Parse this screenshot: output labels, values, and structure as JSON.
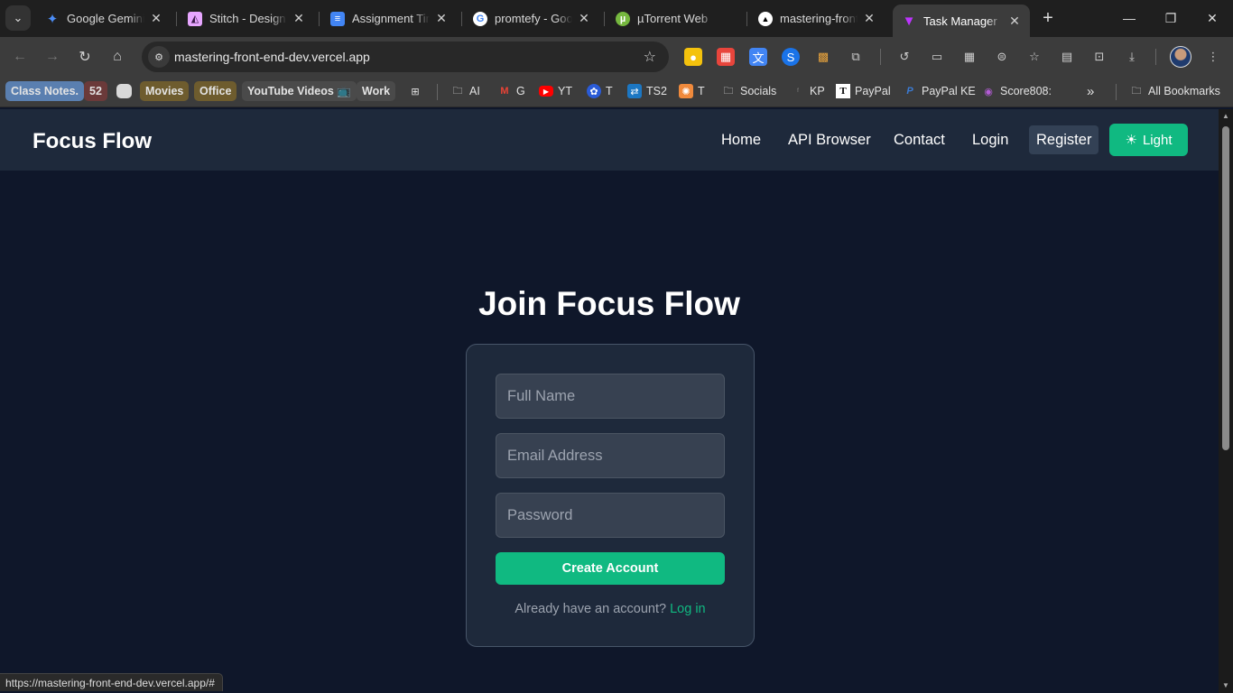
{
  "browser": {
    "tabs": [
      {
        "title": "Google Gemini",
        "icon": "gemini-icon",
        "color": "#4c8df6"
      },
      {
        "title": "Stitch - Design w",
        "icon": "stitch-icon",
        "color": "#e7a6ff"
      },
      {
        "title": "Assignment Tim",
        "icon": "google-docs-icon",
        "color": "#4285f4"
      },
      {
        "title": "promtefy - Goog",
        "icon": "google-icon",
        "color": "#ffffff"
      },
      {
        "title": "µTorrent Web",
        "icon": "utorrent-icon",
        "color": "#76b83f"
      },
      {
        "title": "mastering-front-",
        "icon": "vercel-icon",
        "color": "#ffffff"
      },
      {
        "title": "Task Manager",
        "icon": "vite-icon",
        "color": "#bd34fe",
        "active": true
      }
    ],
    "url": "mastering-front-end-dev.vercel.app",
    "bookmarks": [
      {
        "label": "Class Notes.",
        "style": "chip",
        "bg": "#5a7fb0"
      },
      {
        "label": "52",
        "style": "chip",
        "bg": "#6b3a3a"
      },
      {
        "label": "",
        "style": "chip",
        "bg": "#d9d9d9"
      },
      {
        "label": "Movies",
        "style": "chip",
        "bg": "#6e5c2e"
      },
      {
        "label": "Office",
        "style": "chip",
        "bg": "#6e5c2e"
      },
      {
        "label": "YouTube Videos 📺",
        "style": "chip",
        "bg": "#4a4a4a"
      },
      {
        "label": "Work",
        "style": "chip",
        "bg": "#4a4a4a"
      },
      {
        "label": "AI",
        "icon": "folder-icon"
      },
      {
        "label": "G",
        "icon": "gmail-icon"
      },
      {
        "label": "YT",
        "icon": "youtube-icon"
      },
      {
        "label": "T",
        "icon": "t-icon"
      },
      {
        "label": "TS2",
        "icon": "ts2-icon"
      },
      {
        "label": "T",
        "icon": "t-orange-icon"
      },
      {
        "label": "Socials",
        "icon": "folder-icon"
      },
      {
        "label": "KP",
        "icon": "kp-icon"
      },
      {
        "label": "PayPal",
        "icon": "paypal-t-icon"
      },
      {
        "label": "PayPal KE",
        "icon": "paypal-icon"
      },
      {
        "label": "Score808:",
        "icon": "score-icon"
      }
    ],
    "all_bookmarks": "All Bookmarks",
    "status_url": "https://mastering-front-end-dev.vercel.app/#"
  },
  "app": {
    "brand": "Focus Flow",
    "nav": {
      "home": "Home",
      "api_browser": "API Browser",
      "contact": "Contact",
      "login": "Login",
      "register": "Register",
      "theme_toggle": "Light"
    },
    "form": {
      "heading": "Join Focus Flow",
      "name_placeholder": "Full Name",
      "email_placeholder": "Email Address",
      "password_placeholder": "Password",
      "submit": "Create Account",
      "login_prompt": "Already have an account?",
      "login_link": "Log in"
    }
  },
  "colors": {
    "accent": "#10b981",
    "page_bg": "#0f172a",
    "navbar_bg": "#1e293b"
  }
}
